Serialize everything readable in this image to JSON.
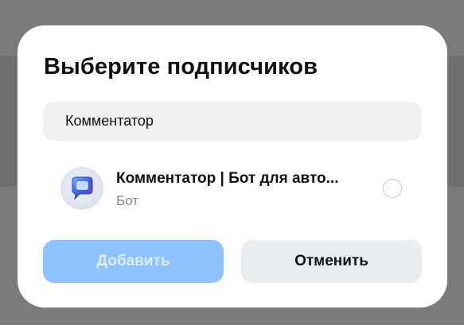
{
  "dialog": {
    "title": "Выберите подписчиков",
    "search": {
      "value": "Комментатор",
      "placeholder": ""
    },
    "results": [
      {
        "name": "Комментатор | Бот для авто...",
        "subtitle": "Бот",
        "avatar_icon": "chat-bubble-icon",
        "selected": false
      }
    ],
    "buttons": {
      "add_label": "Добавить",
      "cancel_label": "Отменить"
    }
  },
  "colors": {
    "overlay": "#7a7a7a",
    "dialog_bg": "#ffffff",
    "add_button_disabled": "#8fc3ff",
    "cancel_button": "#ebecf0",
    "search_bg": "#f0f0f0"
  }
}
